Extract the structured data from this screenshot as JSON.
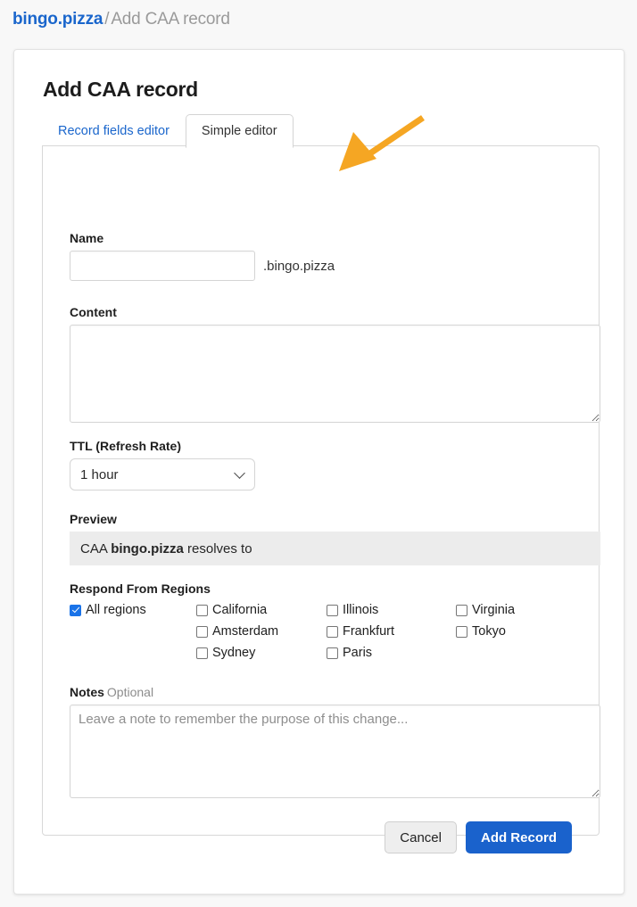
{
  "breadcrumb": {
    "domain": "bingo.pizza",
    "separator": "/",
    "current": "Add CAA record"
  },
  "page": {
    "title": "Add CAA record"
  },
  "tabs": [
    {
      "label": "Record fields editor",
      "active": false
    },
    {
      "label": "Simple editor",
      "active": true
    }
  ],
  "form": {
    "name": {
      "label": "Name",
      "value": "",
      "placeholder": "",
      "suffix": ".bingo.pizza"
    },
    "content": {
      "label": "Content",
      "value": "",
      "placeholder": ""
    },
    "ttl": {
      "label": "TTL (Refresh Rate)",
      "selected": "1 hour",
      "options": [
        "1 hour"
      ]
    },
    "preview": {
      "label": "Preview",
      "prefix": "CAA ",
      "domain": "bingo.pizza",
      "suffix": " resolves to"
    },
    "regions": {
      "label": "Respond From Regions",
      "all": {
        "label": "All regions",
        "checked": true
      },
      "items": [
        {
          "label": "California",
          "checked": false,
          "col": 0,
          "row": 0
        },
        {
          "label": "Amsterdam",
          "checked": false,
          "col": 0,
          "row": 1
        },
        {
          "label": "Sydney",
          "checked": false,
          "col": 0,
          "row": 2
        },
        {
          "label": "Illinois",
          "checked": false,
          "col": 1,
          "row": 0
        },
        {
          "label": "Frankfurt",
          "checked": false,
          "col": 1,
          "row": 1
        },
        {
          "label": "Paris",
          "checked": false,
          "col": 1,
          "row": 2
        },
        {
          "label": "Virginia",
          "checked": false,
          "col": 2,
          "row": 0
        },
        {
          "label": "Tokyo",
          "checked": false,
          "col": 2,
          "row": 1
        }
      ]
    },
    "notes": {
      "label": "Notes",
      "optional_label": "Optional",
      "value": "",
      "placeholder": "Leave a note to remember the purpose of this change..."
    }
  },
  "actions": {
    "cancel_label": "Cancel",
    "submit_label": "Add Record"
  },
  "annotation": {
    "arrow": "orange-arrow-icon",
    "color": "#F5A623"
  },
  "colors": {
    "link_blue": "#1a66cc",
    "primary_button": "#1a62cc",
    "checkbox_blue": "#1a73e8",
    "preview_bg": "#ececec",
    "page_bg": "#f8f8f8",
    "annotation_orange": "#F5A623"
  }
}
